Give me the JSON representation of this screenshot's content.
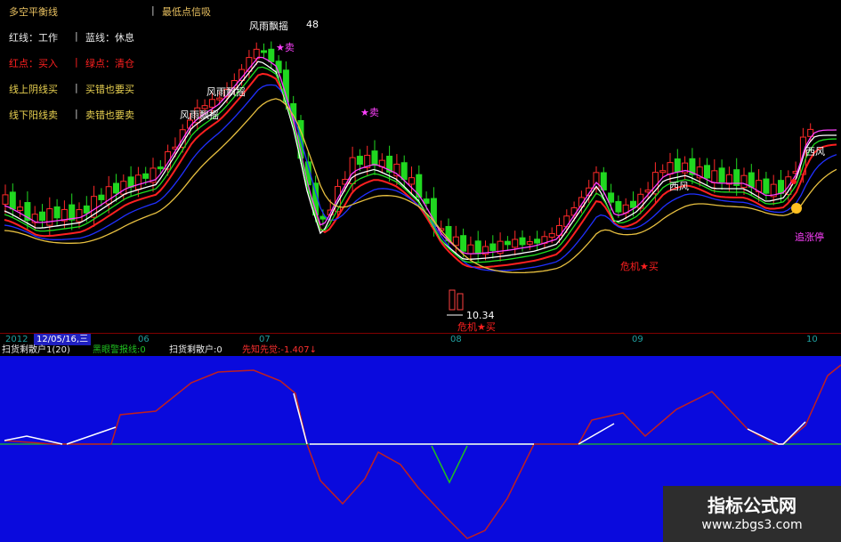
{
  "legend": {
    "title": "多空平衡线",
    "title_right": "最低点信吸",
    "rows": [
      {
        "a": "红线：工作",
        "b": "蓝线：休息"
      },
      {
        "a": "红点：买入",
        "b": "绿点：清仓"
      },
      {
        "a": "线上阴线买",
        "b": "买错也要买"
      },
      {
        "a": "线下阳线卖",
        "b": "卖错也要卖"
      }
    ],
    "separator": "|",
    "colors": {
      "title": "#e8c060",
      "white": "#e8e8e8",
      "red": "#ff2020",
      "yellow": "#e8d050"
    }
  },
  "annotations": {
    "fengyu_labels": [
      "风雨飘摇",
      "风雨飘摇",
      "风雨飘摇"
    ],
    "star_sell": "★卖",
    "high_value": "48",
    "low_value": "10.34",
    "crisis_buy": "危机★买",
    "west_wind": "西风",
    "chase_limit": "追涨停"
  },
  "axis": {
    "year": "2012",
    "cursor_date": "12/05/16,三",
    "ticks": [
      "06",
      "07",
      "08",
      "09",
      "10"
    ]
  },
  "indicator_header": {
    "items": [
      {
        "text": "扫货剩散户1(20)",
        "color": "#e8e8e8"
      },
      {
        "text": "黑眼警报线:0",
        "color": "#20c020"
      },
      {
        "text": "扫货剩散户:0",
        "color": "#e8e8e8"
      },
      {
        "text": "先知先觉:-1.407↓",
        "color": "#ff3030"
      }
    ]
  },
  "watermark": {
    "line1": "指标公式网",
    "line2": "www.zbgs3.com"
  },
  "chart_data": {
    "type": "candlestick",
    "x_ticks": [
      "06",
      "07",
      "08",
      "09",
      "10"
    ],
    "price_high": 48,
    "price_low": 10.34,
    "series": [
      {
        "color": "#ff2020"
      },
      {
        "color": "#2030ff"
      },
      {
        "color": "#ffffff"
      },
      {
        "color": "#ff40ff"
      },
      {
        "color": "#20e020"
      },
      {
        "color": "#e8c040"
      }
    ]
  }
}
